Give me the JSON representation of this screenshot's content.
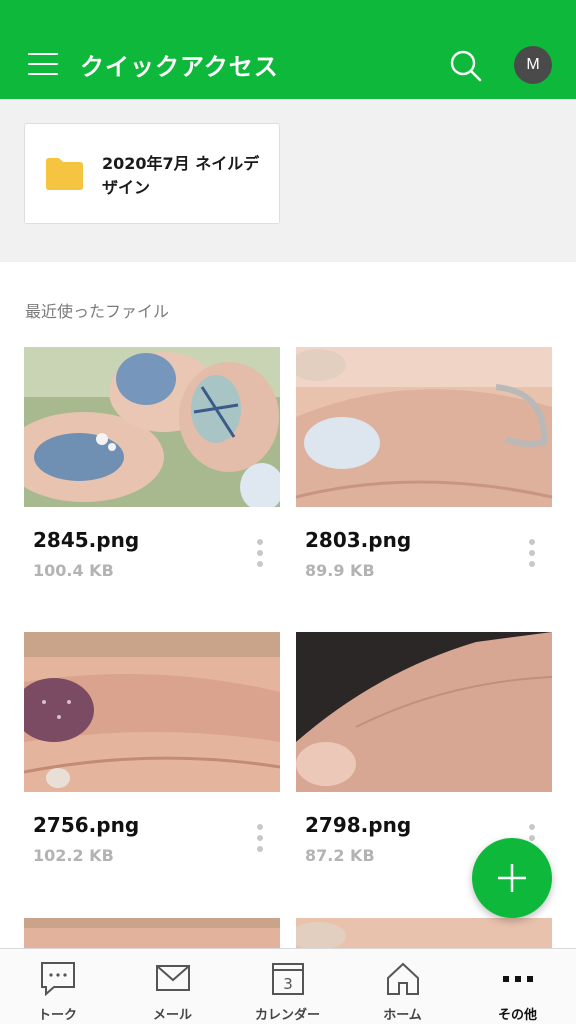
{
  "header": {
    "title": "クイックアクセス",
    "avatar_initial": "M",
    "background": "#0eb83a"
  },
  "quick_access": {
    "folder_name": "2020年7月 ネイルデザイン",
    "folder_color": "#f5c542"
  },
  "recent": {
    "label": "最近使ったファイル",
    "files": [
      {
        "name": "2845.png",
        "size": "100.4 KB"
      },
      {
        "name": "2803.png",
        "size": "89.9 KB"
      },
      {
        "name": "2756.png",
        "size": "102.2 KB"
      },
      {
        "name": "2798.png",
        "size": "87.2 KB"
      }
    ]
  },
  "tabs": [
    {
      "label": "トーク",
      "icon": "chat-bubble-icon"
    },
    {
      "label": "メール",
      "icon": "mail-icon"
    },
    {
      "label": "カレンダー",
      "icon": "calendar-icon",
      "badge": "3"
    },
    {
      "label": "ホーム",
      "icon": "home-icon"
    },
    {
      "label": "その他",
      "icon": "more-horizontal-icon"
    }
  ]
}
